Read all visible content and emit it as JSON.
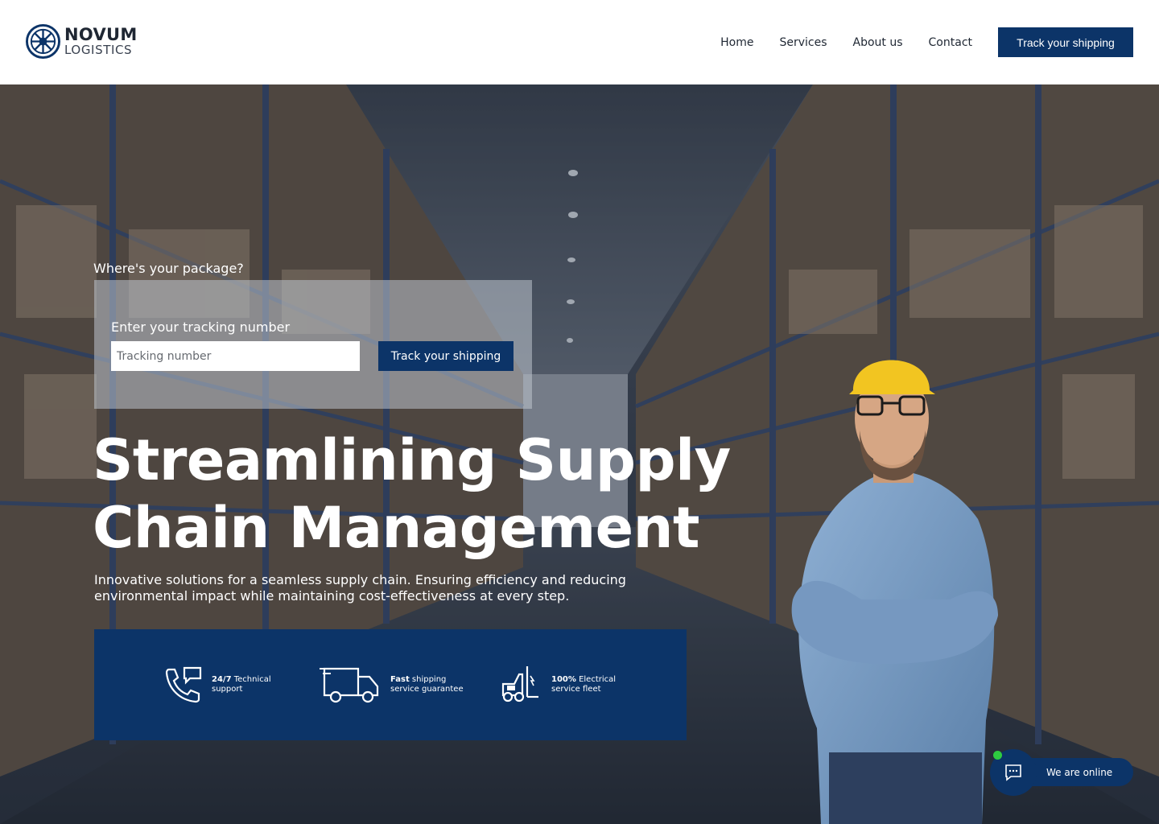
{
  "brand": {
    "name_line1": "NOVUM",
    "name_line2": "LOGISTICS",
    "logo_icon": "ship-wheel-icon",
    "primary_color": "#0c3468"
  },
  "nav": {
    "items": [
      {
        "label": "Home"
      },
      {
        "label": "Services"
      },
      {
        "label": "About us"
      },
      {
        "label": "Contact"
      }
    ],
    "cta_label": "Track your shipping"
  },
  "hero": {
    "background": "warehouse-photo",
    "question": "Where's your package?",
    "tracking": {
      "label": "Enter your tracking number",
      "placeholder": "Tracking number",
      "value": "",
      "button_label": "Track your shipping"
    },
    "headline_line1": "Streamlining Supply",
    "headline_line2": "Chain Management",
    "subheadline_line1": "Innovative solutions for a seamless supply chain. Ensuring efficiency and reducing",
    "subheadline_line2": "environmental impact while maintaining cost-effectiveness at every step.",
    "features": [
      {
        "icon": "phone-chat-icon",
        "strong": "24/7",
        "rest_line1": " Technical",
        "line2": "support"
      },
      {
        "icon": "delivery-truck-icon",
        "strong": "Fast",
        "rest_line1": " shipping",
        "line2": "service guarantee"
      },
      {
        "icon": "electric-forklift-icon",
        "strong": "100%",
        "rest_line1": " Electrical",
        "line2": "service fleet"
      }
    ]
  },
  "chat": {
    "status_label": "We are online",
    "icon": "chat-bubble-icon",
    "online_color": "#2ecc40"
  }
}
